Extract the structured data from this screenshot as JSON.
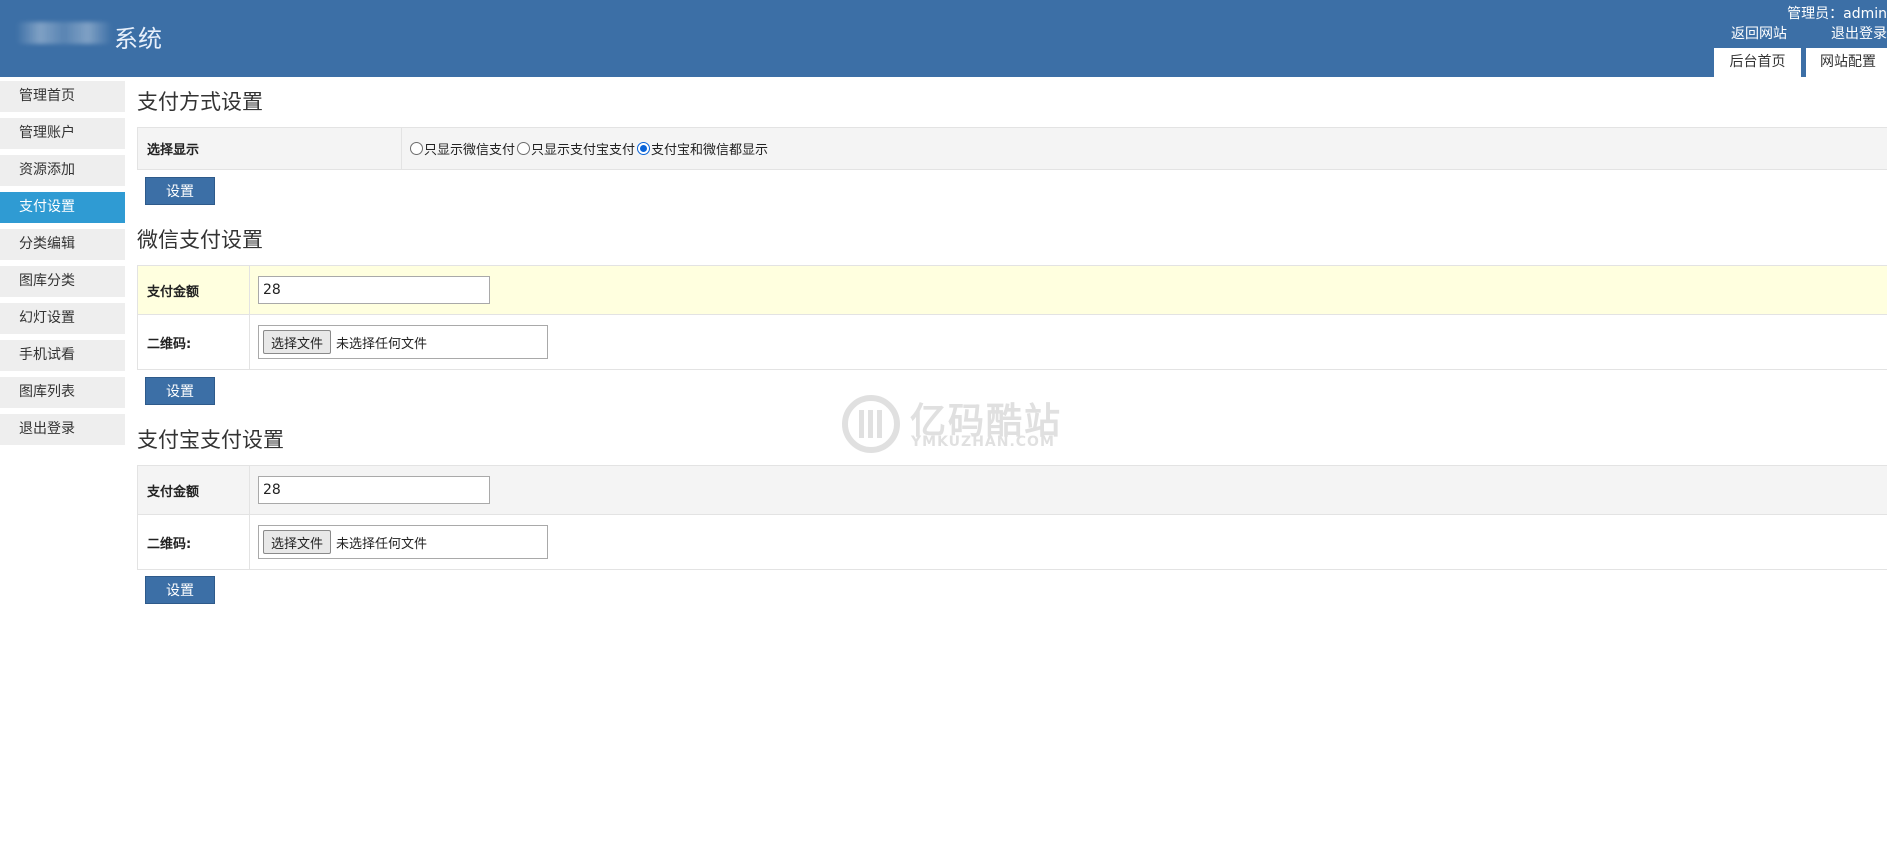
{
  "header": {
    "title": "系统",
    "admin_label": "管理员：admin",
    "links": [
      "返回网站",
      "退出登录"
    ],
    "tabs": [
      "后台首页",
      "网站配置"
    ]
  },
  "sidebar": {
    "items": [
      {
        "label": "管理首页",
        "active": false
      },
      {
        "label": "管理账户",
        "active": false
      },
      {
        "label": "资源添加",
        "active": false
      },
      {
        "label": "支付设置",
        "active": true
      },
      {
        "label": "分类编辑",
        "active": false
      },
      {
        "label": "图库分类",
        "active": false
      },
      {
        "label": "幻灯设置",
        "active": false
      },
      {
        "label": "手机试看",
        "active": false
      },
      {
        "label": "图库列表",
        "active": false
      },
      {
        "label": "退出登录",
        "active": false
      }
    ]
  },
  "payment_method": {
    "title": "支付方式设置",
    "label": "选择显示",
    "options": [
      "只显示微信支付",
      "只显示支付宝支付",
      "支付宝和微信都显示"
    ],
    "selected_index": 2,
    "submit_label": "设置"
  },
  "wechat": {
    "title": "微信支付设置",
    "amount_label": "支付金额",
    "amount_value": "28",
    "qr_label": "二维码:",
    "file_button": "选择文件",
    "file_status": "未选择任何文件",
    "submit_label": "设置"
  },
  "alipay": {
    "title": "支付宝支付设置",
    "amount_label": "支付金额",
    "amount_value": "28",
    "qr_label": "二维码:",
    "file_button": "选择文件",
    "file_status": "未选择任何文件",
    "submit_label": "设置"
  },
  "watermark": {
    "name": "亿码酷站",
    "domain": "YMKUZHAN.COM"
  },
  "colors": {
    "header_bg": "#3c6fa6",
    "sidebar_active": "#2f9bd3",
    "button_bg": "#3c6fa6",
    "highlight_row": "#ffffdf"
  }
}
